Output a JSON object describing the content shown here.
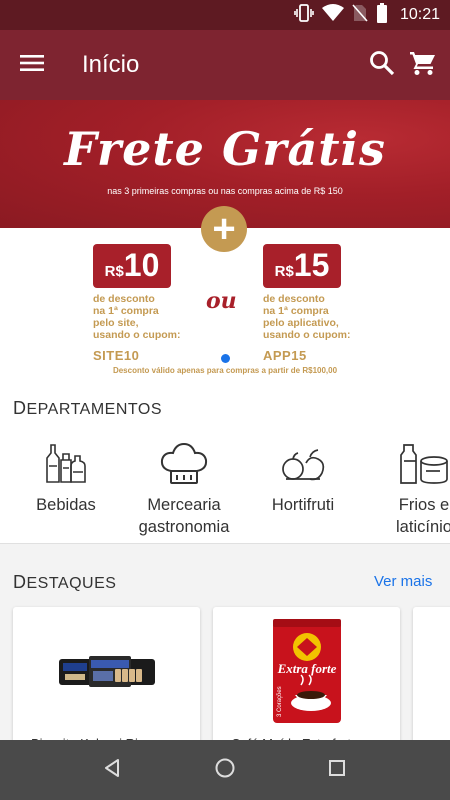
{
  "status_bar": {
    "time": "10:21",
    "icons": [
      "vibrate-icon",
      "wifi-icon",
      "no-sim-icon",
      "battery-icon"
    ]
  },
  "app_bar": {
    "title": "Início",
    "icons": [
      "menu-icon",
      "search-icon",
      "cart-icon"
    ],
    "color": "#7e2430"
  },
  "banner": {
    "title": "Frete Grátis",
    "subtitle": "nas 3 primeiras compras ou nas compras acima de R$ 150",
    "plus": "+",
    "separator": "ou",
    "coupons": [
      {
        "currency": "R$",
        "amount": "10",
        "line1": "de desconto",
        "line2": "na 1ª compra",
        "line3": "pelo site,",
        "line4": "usando o cupom:",
        "code": "SITE10"
      },
      {
        "currency": "R$",
        "amount": "15",
        "line1": "de desconto",
        "line2": "na 1ª compra",
        "line3": "pelo aplicativo,",
        "line4": "usando o cupom:",
        "code": "APP15"
      }
    ],
    "note": "Desconto válido apenas para compras a partir de R$100,00",
    "accent": "#c49a52",
    "brand_red": "#a8202a"
  },
  "departments": {
    "title_initial": "D",
    "title_rest": "EPARTAMENTOS",
    "items": [
      {
        "line1": "Bebidas",
        "line2": "",
        "icon": "bottles-icon"
      },
      {
        "line1": "Mercearia",
        "line2": "gastronomia",
        "icon": "chef-hat-icon"
      },
      {
        "line1": "Hortifruti",
        "line2": "",
        "icon": "fruits-icon"
      },
      {
        "line1": "Frios e",
        "line2": "laticínio",
        "icon": "dairy-icon"
      }
    ]
  },
  "featured": {
    "title_initial": "D",
    "title_rest": "ESTAQUES",
    "see_more": "Ver mais",
    "products": [
      {
        "name": "Biscoito Kalassi Rios",
        "image": "biscuit-package-icon"
      },
      {
        "name": "Café Moído Extraforte",
        "image": "coffee-package-icon",
        "brand": "3 Corações",
        "label": "Extra forte"
      }
    ]
  },
  "nav_bar": {
    "icons": [
      "back-icon",
      "home-icon",
      "recents-icon"
    ]
  }
}
